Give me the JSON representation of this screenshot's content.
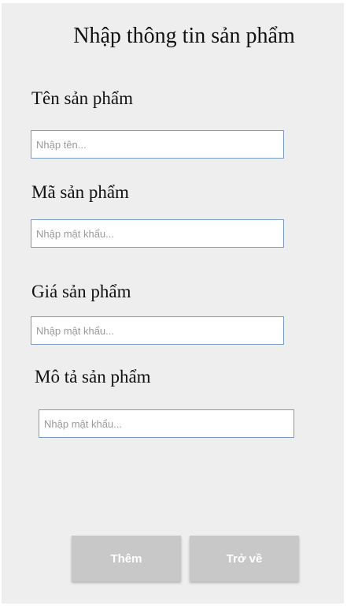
{
  "form": {
    "title": "Nhập thông tin sản phẩm",
    "fields": [
      {
        "label": "Tên sản phẩm",
        "placeholder": "Nhập tên...",
        "value": ""
      },
      {
        "label": "Mã sản phẩm",
        "placeholder": "Nhập mật khẩu...",
        "value": ""
      },
      {
        "label": "Giá sản phẩm",
        "placeholder": "Nhập mật khẩu...",
        "value": ""
      },
      {
        "label": "Mô tả sản phẩm",
        "placeholder": "Nhập mật khẩu...",
        "value": ""
      }
    ],
    "buttons": {
      "add_label": "Thêm",
      "back_label": "Trở về"
    }
  }
}
